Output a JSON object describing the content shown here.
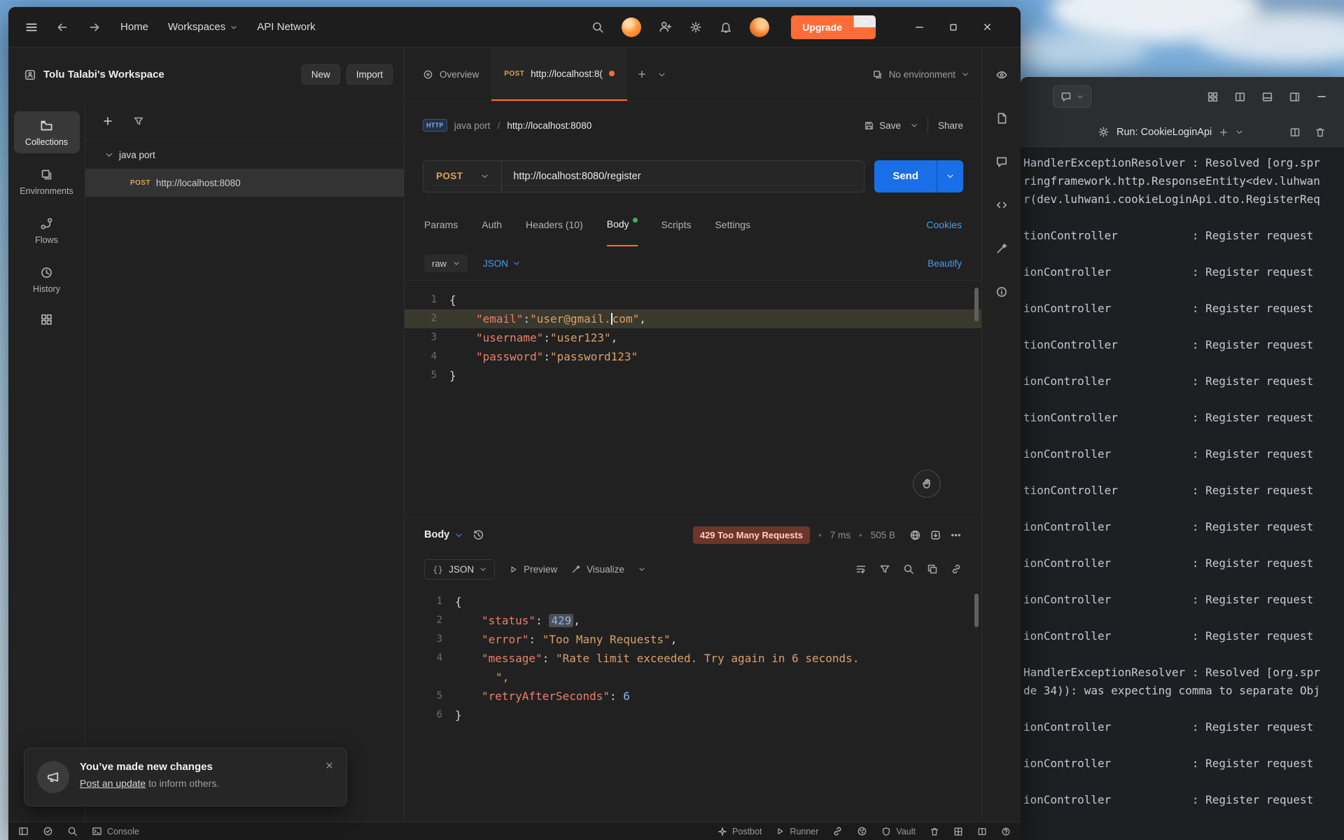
{
  "colors": {
    "postman_orange": "#ff6c37",
    "send_blue": "#1a6fe8",
    "link_blue": "#4c9aef",
    "method_post_amber": "#dca54a",
    "status_error_bg": "#6e352c",
    "status_error_text": "#ffcfc5",
    "body_dot_green": "#34b46a"
  },
  "titlebar": {
    "home": "Home",
    "workspaces": "Workspaces",
    "api_network": "API Network",
    "upgrade": "Upgrade"
  },
  "rail": {
    "collections": "Collections",
    "environments": "Environments",
    "flows": "Flows",
    "history": "History"
  },
  "sidebar": {
    "workspace": "Tolu Talabi's Workspace",
    "new": "New",
    "import": "Import",
    "collection": "java port",
    "request_method": "POST",
    "request_name": "http://localhost:8080"
  },
  "tabs": {
    "overview": "Overview",
    "active_method": "POST",
    "active_title": "http://localhost:8(",
    "environment": "No environment"
  },
  "request": {
    "badge": "HTTP",
    "crumb_collection": "java port",
    "crumb_name": "http://localhost:8080",
    "save": "Save",
    "share": "Share",
    "method": "POST",
    "url": "http://localhost:8080/register",
    "send": "Send",
    "tabs": [
      "Params",
      "Auth",
      "Headers (10)",
      "Body",
      "Scripts",
      "Settings"
    ],
    "cookies": "Cookies",
    "mode": "raw",
    "language": "JSON",
    "beautify": "Beautify",
    "gutter": [
      "1",
      "2",
      "3",
      "4",
      "5"
    ],
    "code": {
      "l1": "{",
      "l2_key": "\"email\"",
      "l2_colon": ":",
      "l2_str1": "\"user@gmail.",
      "l2_str2": "com\"",
      "l2_comma": ",",
      "l3_key": "\"username\"",
      "l3_colon": ":",
      "l3_str": "\"user123\"",
      "l3_comma": ",",
      "l4_key": "\"password\"",
      "l4_colon": ":",
      "l4_str": "\"password123\"",
      "l5": "}"
    }
  },
  "response": {
    "pane": "Body",
    "status": "429 Too Many Requests",
    "time": "7 ms",
    "size": "505 B",
    "language": "JSON",
    "preview": "Preview",
    "visualize": "Visualize",
    "gutter": [
      "1",
      "2",
      "3",
      "4",
      "",
      "5",
      "6"
    ],
    "code": {
      "l1": "{",
      "l2_key": "\"status\"",
      "l2_colon": ": ",
      "l2_num": "429",
      "l2_comma": ",",
      "l3_key": "\"error\"",
      "l3_colon": ": ",
      "l3_str": "\"Too Many Requests\"",
      "l3_comma": ",",
      "l4_key": "\"message\"",
      "l4_colon": ": ",
      "l4_str": "\"Rate limit exceeded. Try again in 6 seconds.",
      "l4_wrap": "\",",
      "l5_key": "\"retryAfterSeconds\"",
      "l5_colon": ": ",
      "l5_num": "6",
      "l6": "}"
    }
  },
  "toast": {
    "title": "You’ve made new changes",
    "link": "Post an update",
    "rest": " to inform others."
  },
  "statusbar": {
    "console": "Console",
    "postbot": "Postbot",
    "runner": "Runner",
    "vault": "Vault"
  },
  "ide": {
    "run_label": "Run: CookieLoginApi",
    "console_lines": [
      "HandlerExceptionResolver : Resolved [org.spr",
      "ringframework.http.ResponseEntity<dev.luhwan",
      "r(dev.luhwani.cookieLoginApi.dto.RegisterReq",
      "",
      "tionController           : Register request",
      "",
      "ionController            : Register request",
      "",
      "ionController            : Register request",
      "",
      "tionController           : Register request",
      "",
      "ionController            : Register request",
      "",
      "tionController           : Register request",
      "",
      "ionController            : Register request",
      "",
      "tionController           : Register request",
      "",
      "ionController            : Register request",
      "",
      "ionController            : Register request",
      "",
      "ionController            : Register request",
      "",
      "ionController            : Register request",
      "",
      "HandlerExceptionResolver : Resolved [org.spr",
      "de 34)): was expecting comma to separate Obj",
      "",
      "ionController            : Register request",
      "",
      "ionController            : Register request",
      "",
      "ionController            : Register request"
    ]
  }
}
